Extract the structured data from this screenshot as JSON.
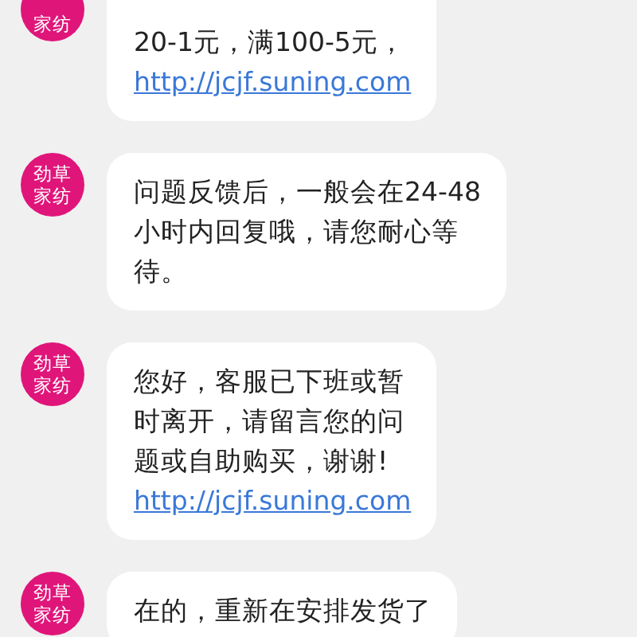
{
  "messages": [
    {
      "avatar": [
        "家纺"
      ],
      "cut_top": true,
      "lines": [
        {
          "kind": "text",
          "text": "20-1元，满100-5元，"
        },
        {
          "kind": "link",
          "text": "http://jcjf.suning.com"
        }
      ]
    },
    {
      "avatar": [
        "劲草",
        "家纺"
      ],
      "lines": [
        {
          "kind": "text",
          "text": "问题反馈后，一般会在24-48"
        },
        {
          "kind": "text",
          "text": "小时内回复哦，请您耐心等"
        },
        {
          "kind": "text",
          "text": "待。"
        }
      ]
    },
    {
      "avatar": [
        "劲草",
        "家纺"
      ],
      "lines": [
        {
          "kind": "text",
          "text": "您好，客服已下班或暂"
        },
        {
          "kind": "text",
          "text": "时离开，请留言您的问"
        },
        {
          "kind": "text",
          "text": "题或自助购买，谢谢!"
        },
        {
          "kind": "link",
          "text": "http://jcjf.suning.com"
        }
      ]
    },
    {
      "avatar": [
        "劲草",
        "家纺"
      ],
      "lines": [
        {
          "kind": "text",
          "text": "在的，重新在安排发货了"
        }
      ]
    }
  ]
}
